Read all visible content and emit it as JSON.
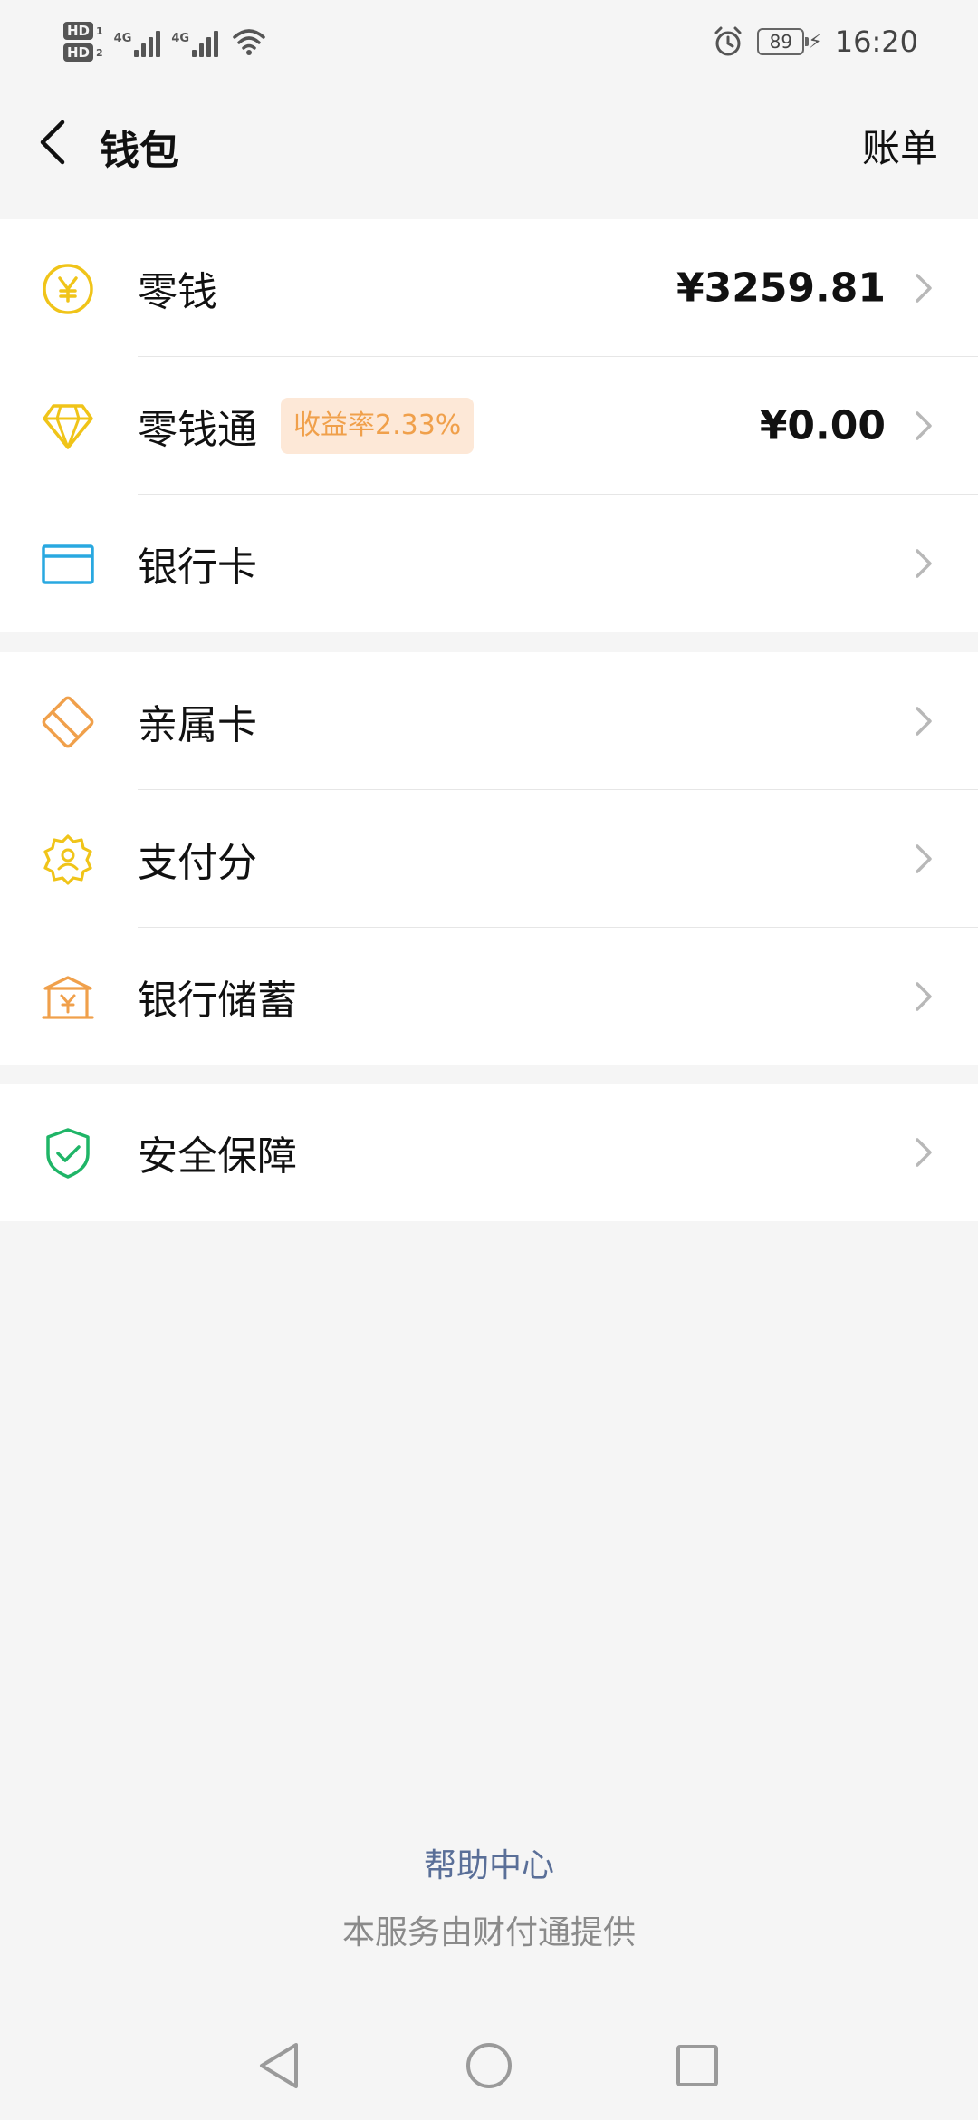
{
  "status_bar": {
    "hd1": "HD",
    "hd1_sub": "1",
    "hd2": "HD",
    "hd2_sub": "2",
    "net1": "4G",
    "net2": "4G",
    "battery": "89",
    "time": "16:20"
  },
  "nav": {
    "title": "钱包",
    "action": "账单"
  },
  "sections": [
    {
      "items": [
        {
          "label": "零钱",
          "value": "¥3259.81",
          "icon": "yuan-coin-icon",
          "color": "#f0c419"
        },
        {
          "label": "零钱通",
          "badge": "收益率2.33%",
          "value": "¥0.00",
          "icon": "diamond-icon",
          "color": "#f0c419"
        },
        {
          "label": "银行卡",
          "icon": "bank-card-icon",
          "color": "#29a8e0"
        }
      ]
    },
    {
      "items": [
        {
          "label": "亲属卡",
          "icon": "family-card-icon",
          "color": "#f0a04b"
        },
        {
          "label": "支付分",
          "icon": "pay-score-icon",
          "color": "#f0c419"
        },
        {
          "label": "银行储蓄",
          "icon": "bank-savings-icon",
          "color": "#f0a04b"
        }
      ]
    },
    {
      "items": [
        {
          "label": "安全保障",
          "icon": "shield-check-icon",
          "color": "#1fb567"
        }
      ]
    }
  ],
  "footer": {
    "help": "帮助中心",
    "provider": "本服务由财付通提供"
  },
  "colors": {
    "background": "#f5f5f5",
    "card": "#ffffff",
    "link": "#5a6f98",
    "badge_bg": "#fde8d7",
    "badge_text": "#f0a04b"
  }
}
